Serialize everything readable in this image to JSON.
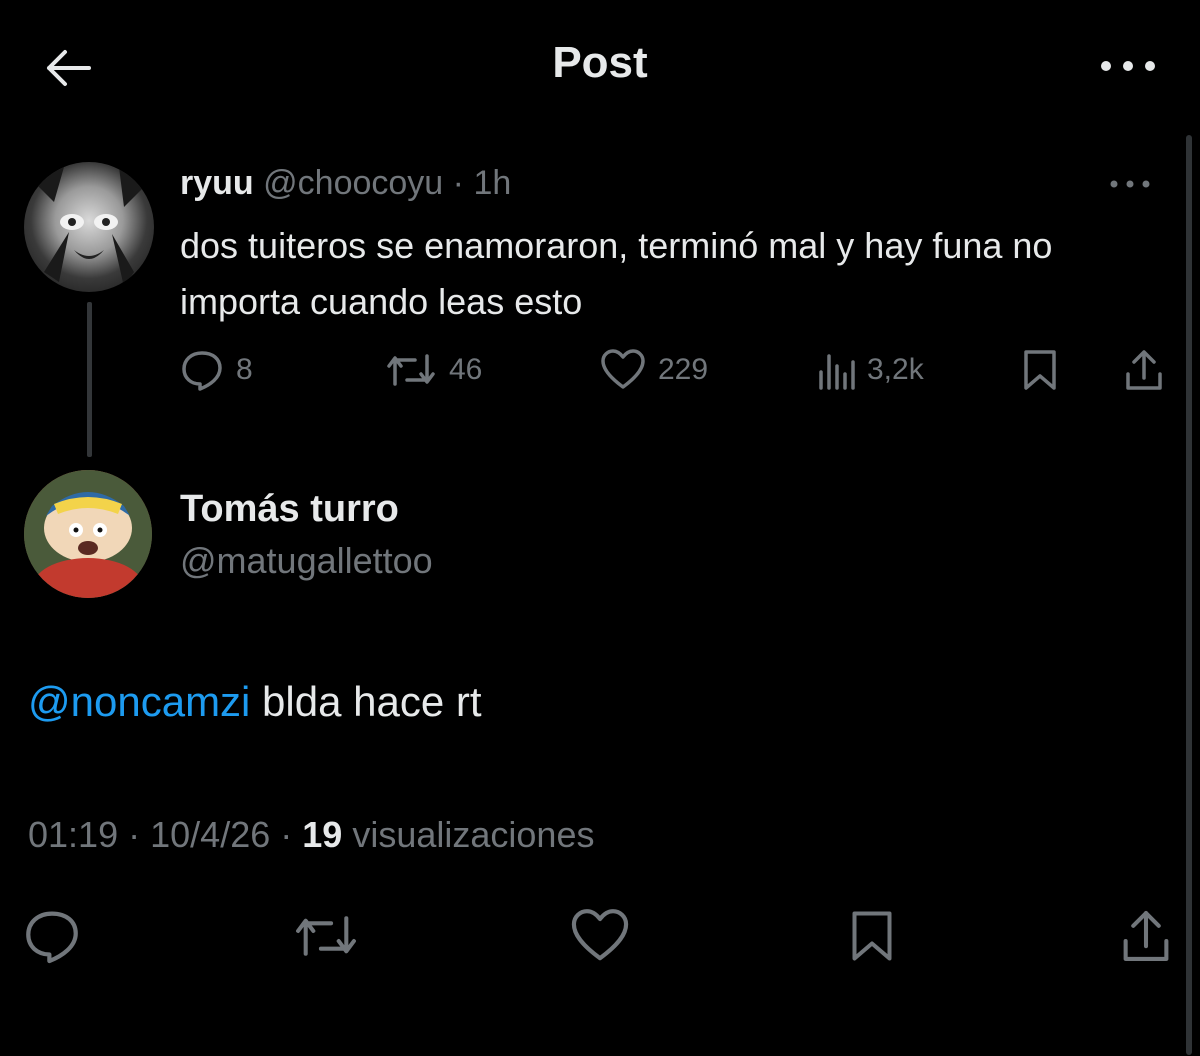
{
  "header": {
    "title": "Post"
  },
  "parent_tweet": {
    "name": "ryuu",
    "handle": "@choocoyu",
    "separator": "·",
    "time": "1h",
    "text": "dos tuiteros se enamoraron, terminó mal y hay funa no importa cuando leas esto",
    "stats": {
      "replies": "8",
      "reposts": "46",
      "likes": "229",
      "views": "3,2k"
    }
  },
  "main_tweet": {
    "name": "Tomás turro",
    "handle": "@matugallettoo",
    "mention": "@noncamzi",
    "text": " blda hace rt",
    "time": "01:19",
    "date": "10/4/26",
    "separator": "·",
    "views_count": "19",
    "views_label": "visualizaciones"
  },
  "colors": {
    "background": "#000000",
    "text": "#e7e9ea",
    "muted": "#71767b",
    "accent": "#1d9bf0"
  }
}
